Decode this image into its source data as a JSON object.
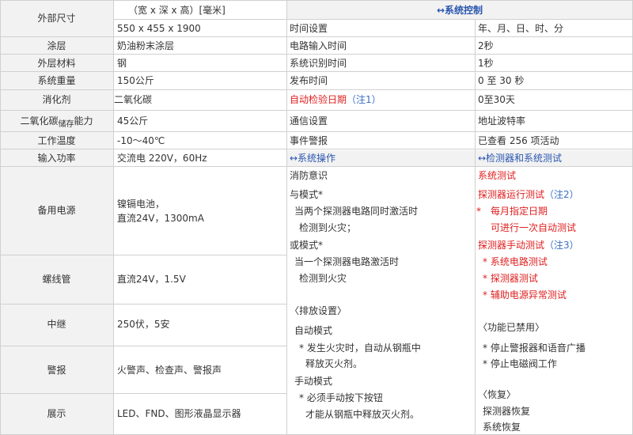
{
  "left_table": {
    "rows": [
      {
        "label": "外部尺寸",
        "value_top": "（宽 x 深 x 高）[毫米]",
        "value": "550 x 455 x 1900"
      },
      {
        "label": "涂层",
        "value": "奶油粉末涂层"
      },
      {
        "label": "外层材料",
        "value": "钢"
      },
      {
        "label": "系统重量",
        "value": "150公斤"
      },
      {
        "label": "消化剂",
        "value": "二氧化碳"
      },
      {
        "label_main": "二氧化碳",
        "label_sub": "储存",
        "label_tail": "能力",
        "value": "45公斤"
      },
      {
        "label": "工作温度",
        "value": "-10～40℃"
      },
      {
        "label": "输入功率",
        "value": "交流电 220V，60Hz"
      },
      {
        "label": "备用电源",
        "value_line1": "镍镉电池，",
        "value_line2": "直流24V，1300mA"
      },
      {
        "label": "螺线管",
        "value": "直流24V，1.5V"
      },
      {
        "label": "中继",
        "value": "250伏，5安"
      },
      {
        "label": "警报",
        "value": "火警声、检查声、警报声"
      },
      {
        "label": "展示",
        "value": "LED、FND、图形液晶显示器"
      }
    ]
  },
  "right_table": {
    "header": "↔系统控制",
    "rows": [
      {
        "label": "时间设置",
        "value": "年、月、日、时、分"
      },
      {
        "label": "电路输入时间",
        "value": "2秒"
      },
      {
        "label": "系统识别时间",
        "value": "1秒"
      },
      {
        "label": "发布时间",
        "value": "0 至 30 秒"
      },
      {
        "label": "自动检验日期",
        "label_note": "（注1）",
        "value": "0至30天"
      },
      {
        "label": "通信设置",
        "value": "地址波特率"
      },
      {
        "label": "事件警报",
        "value": "已查看 256 项活动"
      }
    ],
    "ops_header": "↔系统操作",
    "test_header": "↔检测器和系统测试",
    "ops_lines": [
      "消防意识",
      "与模式*",
      "当两个探测器电路同时激活时",
      "检测到火灾；",
      "或模式*",
      "当一个探测器电路激活时",
      "检测到火灾",
      "〈排放设置〉",
      "自动模式",
      "* 发生火灾时，自动从钢瓶中",
      "释放灭火剂。",
      "手动模式",
      "* 必须手动按下按钮",
      "才能从钢瓶中释放灭火剂。"
    ],
    "test_lines": {
      "system_test": "系统测试",
      "detector_run_test": "探测器运行测试",
      "note2": "（注2）",
      "monthly_a": "*　每月指定日期",
      "monthly_b": "可进行一次自动测试",
      "detector_manual_test": "探测器手动测试",
      "note3": "（注3）",
      "circuit_test": "* 系统电路测试",
      "detector_test": "* 探测器测试",
      "aux_test": "* 辅助电源异常测试",
      "disabled_header": "〈功能已禁用〉",
      "stop_alarm": "* 停止警报器和语音广播",
      "stop_valve": "* 停止电磁阀工作",
      "recover_header": "〈恢复〉",
      "detector_recover": "探测器恢复",
      "system_recover": "系统恢复"
    }
  },
  "colors": {
    "label_bg": "#f2f2f2",
    "border": "#d0d0d0",
    "red": "#e02020",
    "blue": "#2a56b0"
  }
}
